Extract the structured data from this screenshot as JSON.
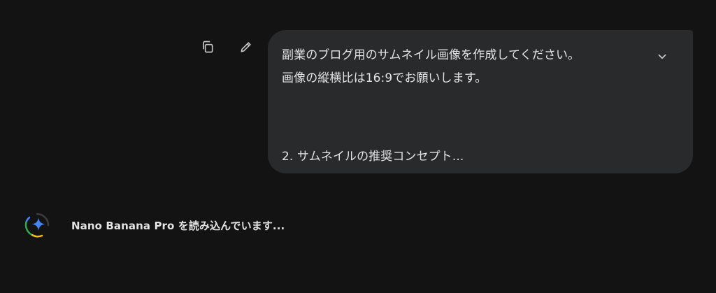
{
  "user_message": {
    "lines": [
      "副業のブログ用のサムネイル画像を作成してください。",
      "画像の縦横比は16:9でお願いします。",
      "2. サムネイルの推奨コンセプト..."
    ]
  },
  "actions": {
    "copy_icon": "copy-icon",
    "edit_icon": "pencil-icon",
    "expand_icon": "chevron-down-icon"
  },
  "status": {
    "text": "Nano Banana Pro を読み込んでいます..."
  },
  "colors": {
    "background": "#131314",
    "bubble": "#282a2c",
    "text": "#e3e3e3",
    "spark_blue": "#4285f4"
  }
}
